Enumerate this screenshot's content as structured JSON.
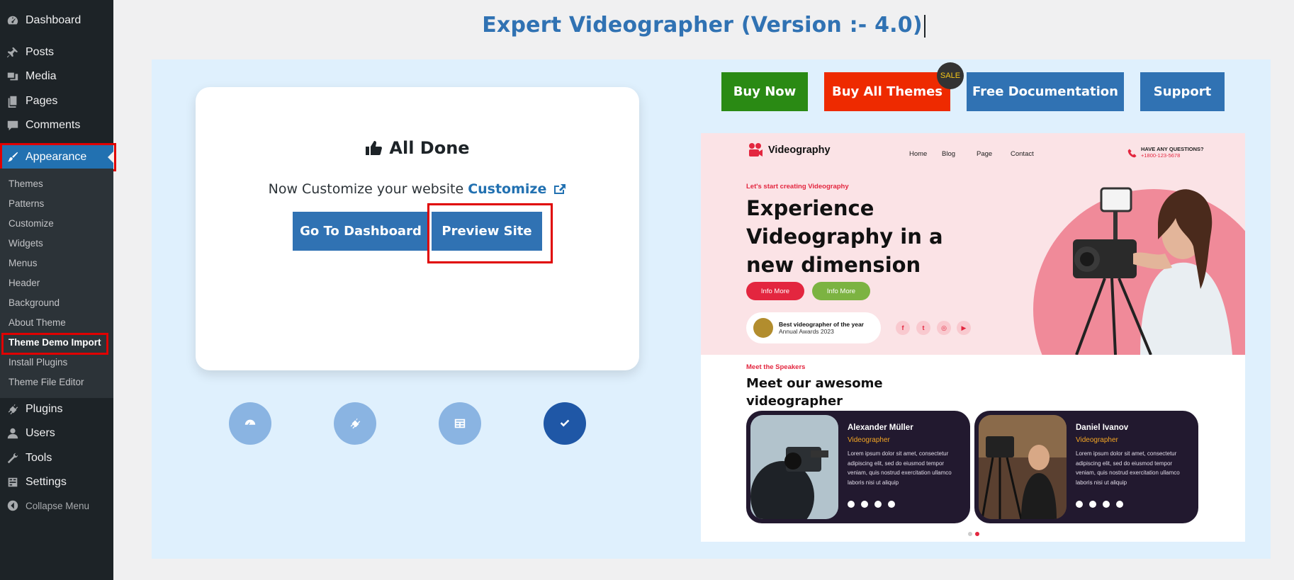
{
  "sidebar": {
    "menu": [
      {
        "label": "Dashboard",
        "icon": "dashboard-icon"
      },
      {
        "label": "Posts",
        "icon": "pin-icon"
      },
      {
        "label": "Media",
        "icon": "media-icon"
      },
      {
        "label": "Pages",
        "icon": "pages-icon"
      },
      {
        "label": "Comments",
        "icon": "comment-icon"
      },
      {
        "label": "Appearance",
        "icon": "brush-icon"
      },
      {
        "label": "Plugins",
        "icon": "plugin-icon"
      },
      {
        "label": "Users",
        "icon": "user-icon"
      },
      {
        "label": "Tools",
        "icon": "wrench-icon"
      },
      {
        "label": "Settings",
        "icon": "settings-icon"
      },
      {
        "label": "Collapse Menu",
        "icon": "collapse-icon"
      }
    ],
    "submenu": [
      "Themes",
      "Patterns",
      "Customize",
      "Widgets",
      "Menus",
      "Header",
      "Background",
      "About Theme",
      "Theme Demo Import",
      "Install Plugins",
      "Theme File Editor"
    ]
  },
  "header": {
    "title": "Expert Videographer (Version :- 4.0)"
  },
  "card": {
    "heading": "All Done",
    "customize_text": "Now Customize your website",
    "customize_link": "Customize",
    "dashboard_button": "Go To Dashboard",
    "preview_button": "Preview Site"
  },
  "top_buttons": {
    "buy_now": "Buy Now",
    "buy_all": "Buy All Themes",
    "sale_badge": "SALE",
    "docs": "Free Documentation",
    "support": "Support"
  },
  "preview": {
    "logo": "Videography",
    "nav": [
      "Home",
      "Blog",
      "Page",
      "Contact"
    ],
    "question": "HAVE ANY QUESTIONS?",
    "phone": "+1800-123-5678",
    "kicker": "Let's start creating Videography",
    "headline": "Experience Videography in a new dimension",
    "btn1": "Info More",
    "btn2": "Info More",
    "award_title": "Best videographer of the year",
    "award_sub": "Annual Awards 2023",
    "speakers_kicker": "Meet the Speakers",
    "speakers_title": "Meet our awesome videographer",
    "speakers": [
      {
        "name": "Alexander Müller",
        "role": "Videographer",
        "text": "Lorem ipsum dolor sit amet, consectetur adipiscing elit, sed do eiusmod tempor veniam, quis nostrud exercitation ullamco laboris nisi ut aliquip"
      },
      {
        "name": "Daniel Ivanov",
        "role": "Videographer",
        "text": "Lorem ipsum dolor sit amet, consectetur adipiscing elit, sed do eiusmod tempor veniam, quis nostrud exercitation ullamco laboris nisi ut aliquip"
      }
    ]
  },
  "colors": {
    "sidebar_bg": "#1d2327",
    "accent_blue": "#3072b3",
    "buy_now_green": "#2a8a14",
    "buy_all_red": "#ee2a00",
    "highlight_red": "#e00000",
    "preview_pink": "#e3263f"
  }
}
